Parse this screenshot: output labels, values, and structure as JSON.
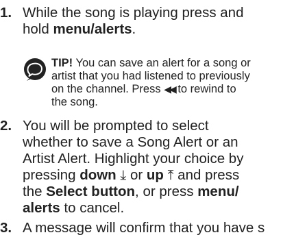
{
  "steps": [
    {
      "number": "1.",
      "lines": [
        {
          "text": "While the song is playing press and"
        },
        {
          "pre": "hold ",
          "bold": "menu/alerts",
          "post": "."
        }
      ]
    },
    {
      "number": "2.",
      "lines": [
        {
          "text": "You will be prompted to select"
        },
        {
          "text": "whether to save a Song Alert or an"
        },
        {
          "text": "Artist Alert. Highlight your choice by"
        },
        {
          "pre": "pressing ",
          "bold": "down",
          "glyph1": "⤓",
          "mid": " or ",
          "bold2": "up",
          "glyph2": "⤒",
          "post": " and press"
        },
        {
          "pre": "the ",
          "bold": "Select button",
          "post": ", or press ",
          "bold2": "menu/"
        },
        {
          "bold": "alerts",
          "post": " to cancel."
        }
      ]
    },
    {
      "number": "3.",
      "lines": [
        {
          "text": "A message will confirm that you have s"
        }
      ]
    }
  ],
  "tip": {
    "icon": "speech-bubble-icon",
    "label": "TIP!",
    "line1_rest": " You can save an alert for a song or",
    "line2": "artist that you had listened to previously",
    "line3_pre": "on the channel. Press ",
    "rewind_glyph": "◀◀",
    "line3_post": " to rewind to",
    "line4": "the song."
  },
  "colors": {
    "text": "#222222",
    "background": "#ffffff"
  }
}
